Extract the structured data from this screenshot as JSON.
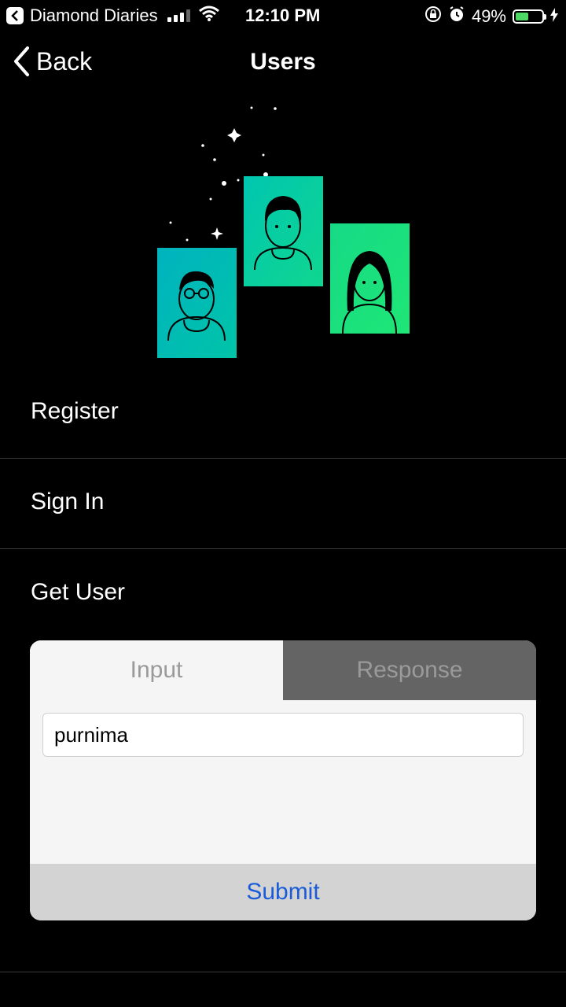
{
  "status_bar": {
    "back_app": "Diamond Diaries",
    "time": "12:10 PM",
    "battery": "49%",
    "battery_level": 0.49,
    "signal_bars_on": 3,
    "signal_bars_total": 4
  },
  "nav": {
    "back_label": "Back",
    "title": "Users"
  },
  "list": {
    "register": "Register",
    "sign_in": "Sign In",
    "get_user": "Get User"
  },
  "card": {
    "tab_input": "Input",
    "tab_response": "Response",
    "field_value": "purnima",
    "submit_label": "Submit"
  },
  "colors": {
    "accent_blue": "#1a5cd8",
    "card_teal": "#00b8b8",
    "card_green": "#1de27a",
    "battery_green": "#4cd964"
  }
}
